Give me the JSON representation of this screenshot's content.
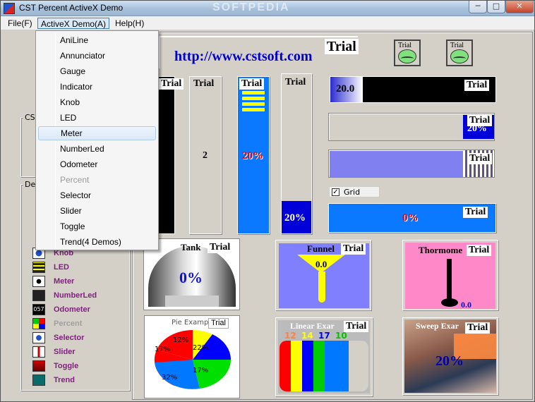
{
  "window": {
    "title": "CST Percent ActiveX Demo",
    "watermark": "SOFTPEDIA",
    "min": "─",
    "max": "□",
    "close": "✕"
  },
  "menu": {
    "file": "File(F)",
    "activex": "ActiveX Demo(A)",
    "help": "Help(H)"
  },
  "dropdown": [
    {
      "label": "AniLine",
      "disabled": false
    },
    {
      "label": "Annunciator",
      "disabled": false
    },
    {
      "label": "Gauge",
      "disabled": false
    },
    {
      "label": "Indicator",
      "disabled": false
    },
    {
      "label": "Knob",
      "disabled": false
    },
    {
      "label": "LED",
      "disabled": false
    },
    {
      "label": "Meter",
      "disabled": false,
      "hover": true
    },
    {
      "label": "NumberLed",
      "disabled": false
    },
    {
      "label": "Odometer",
      "disabled": false
    },
    {
      "label": "Percent",
      "disabled": true
    },
    {
      "label": "Selector",
      "disabled": false
    },
    {
      "label": "Slider",
      "disabled": false
    },
    {
      "label": "Toggle",
      "disabled": false
    },
    {
      "label": "Trend(4 Demos)",
      "disabled": false
    }
  ],
  "left_panel": {
    "group1_label": "CS",
    "group2_label": "De",
    "items": [
      {
        "label": "Knob",
        "disabled": false,
        "icon": "knob-icon"
      },
      {
        "label": "LED",
        "disabled": false,
        "icon": "led-icon"
      },
      {
        "label": "Meter",
        "disabled": false,
        "icon": "meter-icon"
      },
      {
        "label": "NumberLed",
        "disabled": false,
        "icon": "numberled-icon"
      },
      {
        "label": "Odometer",
        "disabled": false,
        "icon": "odometer-icon"
      },
      {
        "label": "Percent",
        "disabled": true,
        "icon": "percent-icon"
      },
      {
        "label": "Selector",
        "disabled": false,
        "icon": "selector-icon"
      },
      {
        "label": "Slider",
        "disabled": false,
        "icon": "slider-icon"
      },
      {
        "label": "Toggle",
        "disabled": false,
        "icon": "toggle-icon"
      },
      {
        "label": "Trend",
        "disabled": false,
        "icon": "trend-icon"
      }
    ],
    "odometer_icon_text": "057"
  },
  "main": {
    "url": "http://www.cstsoft.com",
    "trial": "Trial",
    "bar_value_20_0": "20.0",
    "value_2": "2",
    "pct_red": "20%",
    "pct_white": "20%",
    "pct_hbar2": "20%",
    "pct_hbar5": "0%",
    "grid_label": "Grid",
    "tank_label": "Tank",
    "tank_value": "0%",
    "funnel_label": "Funnel",
    "funnel_value": "0.0",
    "thermo_label": "Thormome",
    "thermo_value": "0.0",
    "pie_label": "Pie Examp",
    "pie_slices": [
      "17%",
      "12%",
      "22%",
      "17%",
      "32%"
    ],
    "linear_label": "Linear Exar",
    "linear_values": [
      "12",
      "14",
      "17",
      "10"
    ],
    "sweep_label": "Sweep Exar",
    "sweep_value": "20%"
  },
  "colors": {
    "blue": "#0078ff",
    "navy": "#0000c8",
    "yellow": "#ffff00",
    "red": "#ff0000"
  }
}
